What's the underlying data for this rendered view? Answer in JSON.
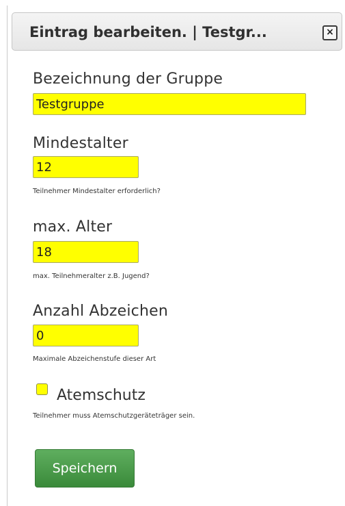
{
  "dialog": {
    "title": "Eintrag bearbeiten. | Testgr...",
    "close_glyph": "×",
    "close_icon": "close-icon"
  },
  "fields": {
    "group_name": {
      "label": "Bezeichnung der Gruppe",
      "value": "Testgruppe"
    },
    "min_age": {
      "label": "Mindestalter",
      "value": "12",
      "help": "Teilnehmer Mindestalter erforderlich?"
    },
    "max_age": {
      "label": "max. Alter",
      "value": "18",
      "help": "max. Teilnehmeralter z.B. Jugend?"
    },
    "badge_count": {
      "label": "Anzahl Abzeichen",
      "value": "0",
      "help": "Maximale Abzeichenstufe dieser Art"
    },
    "breathing": {
      "label": "Atemschutz",
      "checked": false,
      "help": "Teilnehmer muss Atemschutzgeräteträger sein."
    }
  },
  "actions": {
    "save_label": "Speichern"
  },
  "colors": {
    "field_highlight": "#ffff00",
    "save_button": "#4a9a4a"
  }
}
